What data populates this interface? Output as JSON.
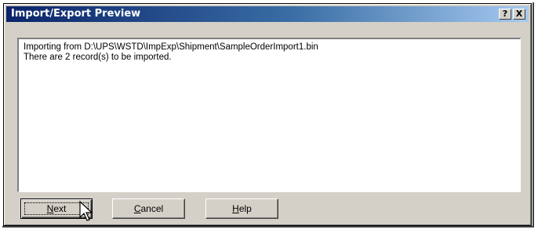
{
  "window": {
    "title": "Import/Export Preview",
    "help_button": "?",
    "close_button": "X"
  },
  "log": {
    "lines": [
      "Importing from D:\\UPS\\WSTD\\ImpExp\\Shipment\\SampleOrderImport1.bin",
      "There are 2 record(s) to be imported."
    ]
  },
  "buttons": {
    "next_label": "Next",
    "cancel_label": "Cancel",
    "help_label": "Help"
  },
  "colors": {
    "titlebar_start": "#0a246a",
    "titlebar_end": "#a6caf0",
    "dialog_face": "#d4d0c8"
  },
  "icons": {
    "cursor": "arrow-pointer-icon"
  }
}
